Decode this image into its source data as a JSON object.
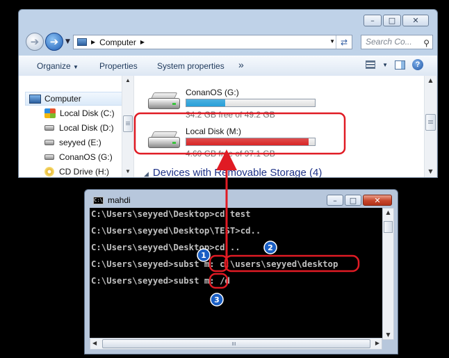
{
  "explorer": {
    "address": "Computer",
    "search_placeholder": "Search Co...",
    "toolbar": {
      "organize": "Organize",
      "properties": "Properties",
      "system_properties": "System properties",
      "more": "»"
    },
    "nav_items": [
      {
        "label": "Computer",
        "icon": "computer-icon"
      },
      {
        "label": "Local Disk (C:)",
        "icon": "windows-drive-icon"
      },
      {
        "label": "Local Disk (D:)",
        "icon": "drive-icon"
      },
      {
        "label": "seyyed (E:)",
        "icon": "drive-icon"
      },
      {
        "label": "ConanOS (G:)",
        "icon": "drive-icon"
      },
      {
        "label": "CD Drive (H:)",
        "icon": "cd-drive-icon"
      }
    ],
    "drives": [
      {
        "name": "ConanOS (G:)",
        "free": "34.2 GB free of 49.2 GB",
        "used_fraction": 0.3,
        "bar_color": "#26a0da"
      },
      {
        "name": "Local Disk (M:)",
        "free": "4.60 GB free of 97.1 GB",
        "used_fraction": 0.95,
        "bar_color": "#da2626"
      }
    ],
    "group_header": "Devices with Removable Storage (4)"
  },
  "console": {
    "title": "mahdi",
    "lines": [
      "C:\\Users\\seyyed\\Desktop>cd test",
      "",
      "C:\\Users\\seyyed\\Desktop\\TEST>cd..",
      "",
      "C:\\Users\\seyyed\\Desktop>cd ..",
      "",
      "C:\\Users\\seyyed>subst m: c:\\users\\seyyed\\desktop",
      "",
      "C:\\Users\\seyyed>subst m: /d"
    ]
  },
  "annotations": {
    "badges": [
      "1",
      "2",
      "3"
    ],
    "color": "#e01b24",
    "badge_color": "#1a5fc4"
  }
}
